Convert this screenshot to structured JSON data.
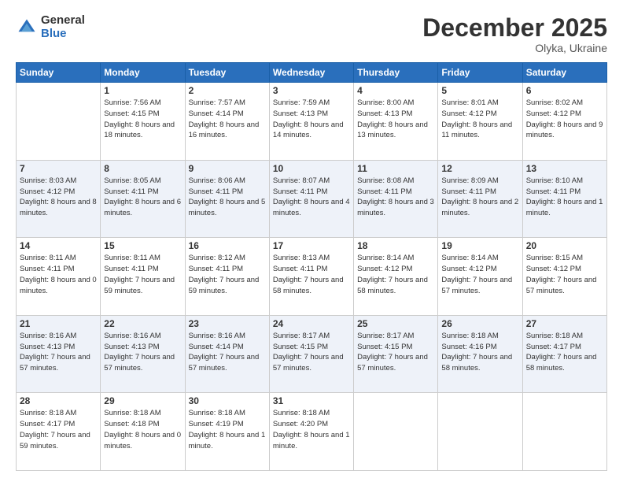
{
  "header": {
    "logo_general": "General",
    "logo_blue": "Blue",
    "month_title": "December 2025",
    "subtitle": "Olyka, Ukraine"
  },
  "days_of_week": [
    "Sunday",
    "Monday",
    "Tuesday",
    "Wednesday",
    "Thursday",
    "Friday",
    "Saturday"
  ],
  "weeks": [
    [
      {
        "day": "",
        "sunrise": "",
        "sunset": "",
        "daylight": ""
      },
      {
        "day": "1",
        "sunrise": "Sunrise: 7:56 AM",
        "sunset": "Sunset: 4:15 PM",
        "daylight": "Daylight: 8 hours and 18 minutes."
      },
      {
        "day": "2",
        "sunrise": "Sunrise: 7:57 AM",
        "sunset": "Sunset: 4:14 PM",
        "daylight": "Daylight: 8 hours and 16 minutes."
      },
      {
        "day": "3",
        "sunrise": "Sunrise: 7:59 AM",
        "sunset": "Sunset: 4:13 PM",
        "daylight": "Daylight: 8 hours and 14 minutes."
      },
      {
        "day": "4",
        "sunrise": "Sunrise: 8:00 AM",
        "sunset": "Sunset: 4:13 PM",
        "daylight": "Daylight: 8 hours and 13 minutes."
      },
      {
        "day": "5",
        "sunrise": "Sunrise: 8:01 AM",
        "sunset": "Sunset: 4:12 PM",
        "daylight": "Daylight: 8 hours and 11 minutes."
      },
      {
        "day": "6",
        "sunrise": "Sunrise: 8:02 AM",
        "sunset": "Sunset: 4:12 PM",
        "daylight": "Daylight: 8 hours and 9 minutes."
      }
    ],
    [
      {
        "day": "7",
        "sunrise": "Sunrise: 8:03 AM",
        "sunset": "Sunset: 4:12 PM",
        "daylight": "Daylight: 8 hours and 8 minutes."
      },
      {
        "day": "8",
        "sunrise": "Sunrise: 8:05 AM",
        "sunset": "Sunset: 4:11 PM",
        "daylight": "Daylight: 8 hours and 6 minutes."
      },
      {
        "day": "9",
        "sunrise": "Sunrise: 8:06 AM",
        "sunset": "Sunset: 4:11 PM",
        "daylight": "Daylight: 8 hours and 5 minutes."
      },
      {
        "day": "10",
        "sunrise": "Sunrise: 8:07 AM",
        "sunset": "Sunset: 4:11 PM",
        "daylight": "Daylight: 8 hours and 4 minutes."
      },
      {
        "day": "11",
        "sunrise": "Sunrise: 8:08 AM",
        "sunset": "Sunset: 4:11 PM",
        "daylight": "Daylight: 8 hours and 3 minutes."
      },
      {
        "day": "12",
        "sunrise": "Sunrise: 8:09 AM",
        "sunset": "Sunset: 4:11 PM",
        "daylight": "Daylight: 8 hours and 2 minutes."
      },
      {
        "day": "13",
        "sunrise": "Sunrise: 8:10 AM",
        "sunset": "Sunset: 4:11 PM",
        "daylight": "Daylight: 8 hours and 1 minute."
      }
    ],
    [
      {
        "day": "14",
        "sunrise": "Sunrise: 8:11 AM",
        "sunset": "Sunset: 4:11 PM",
        "daylight": "Daylight: 8 hours and 0 minutes."
      },
      {
        "day": "15",
        "sunrise": "Sunrise: 8:11 AM",
        "sunset": "Sunset: 4:11 PM",
        "daylight": "Daylight: 7 hours and 59 minutes."
      },
      {
        "day": "16",
        "sunrise": "Sunrise: 8:12 AM",
        "sunset": "Sunset: 4:11 PM",
        "daylight": "Daylight: 7 hours and 59 minutes."
      },
      {
        "day": "17",
        "sunrise": "Sunrise: 8:13 AM",
        "sunset": "Sunset: 4:11 PM",
        "daylight": "Daylight: 7 hours and 58 minutes."
      },
      {
        "day": "18",
        "sunrise": "Sunrise: 8:14 AM",
        "sunset": "Sunset: 4:12 PM",
        "daylight": "Daylight: 7 hours and 58 minutes."
      },
      {
        "day": "19",
        "sunrise": "Sunrise: 8:14 AM",
        "sunset": "Sunset: 4:12 PM",
        "daylight": "Daylight: 7 hours and 57 minutes."
      },
      {
        "day": "20",
        "sunrise": "Sunrise: 8:15 AM",
        "sunset": "Sunset: 4:12 PM",
        "daylight": "Daylight: 7 hours and 57 minutes."
      }
    ],
    [
      {
        "day": "21",
        "sunrise": "Sunrise: 8:16 AM",
        "sunset": "Sunset: 4:13 PM",
        "daylight": "Daylight: 7 hours and 57 minutes."
      },
      {
        "day": "22",
        "sunrise": "Sunrise: 8:16 AM",
        "sunset": "Sunset: 4:13 PM",
        "daylight": "Daylight: 7 hours and 57 minutes."
      },
      {
        "day": "23",
        "sunrise": "Sunrise: 8:16 AM",
        "sunset": "Sunset: 4:14 PM",
        "daylight": "Daylight: 7 hours and 57 minutes."
      },
      {
        "day": "24",
        "sunrise": "Sunrise: 8:17 AM",
        "sunset": "Sunset: 4:15 PM",
        "daylight": "Daylight: 7 hours and 57 minutes."
      },
      {
        "day": "25",
        "sunrise": "Sunrise: 8:17 AM",
        "sunset": "Sunset: 4:15 PM",
        "daylight": "Daylight: 7 hours and 57 minutes."
      },
      {
        "day": "26",
        "sunrise": "Sunrise: 8:18 AM",
        "sunset": "Sunset: 4:16 PM",
        "daylight": "Daylight: 7 hours and 58 minutes."
      },
      {
        "day": "27",
        "sunrise": "Sunrise: 8:18 AM",
        "sunset": "Sunset: 4:17 PM",
        "daylight": "Daylight: 7 hours and 58 minutes."
      }
    ],
    [
      {
        "day": "28",
        "sunrise": "Sunrise: 8:18 AM",
        "sunset": "Sunset: 4:17 PM",
        "daylight": "Daylight: 7 hours and 59 minutes."
      },
      {
        "day": "29",
        "sunrise": "Sunrise: 8:18 AM",
        "sunset": "Sunset: 4:18 PM",
        "daylight": "Daylight: 8 hours and 0 minutes."
      },
      {
        "day": "30",
        "sunrise": "Sunrise: 8:18 AM",
        "sunset": "Sunset: 4:19 PM",
        "daylight": "Daylight: 8 hours and 1 minute."
      },
      {
        "day": "31",
        "sunrise": "Sunrise: 8:18 AM",
        "sunset": "Sunset: 4:20 PM",
        "daylight": "Daylight: 8 hours and 1 minute."
      },
      {
        "day": "",
        "sunrise": "",
        "sunset": "",
        "daylight": ""
      },
      {
        "day": "",
        "sunrise": "",
        "sunset": "",
        "daylight": ""
      },
      {
        "day": "",
        "sunrise": "",
        "sunset": "",
        "daylight": ""
      }
    ]
  ]
}
